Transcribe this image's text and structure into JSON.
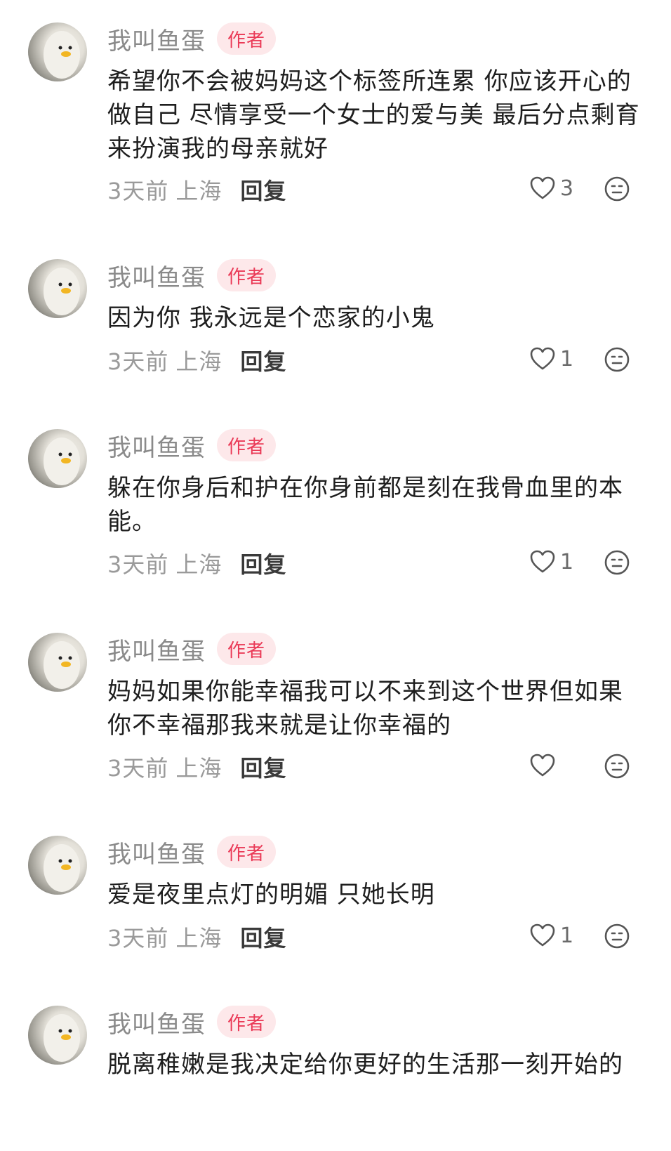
{
  "comments": [
    {
      "username": "我叫鱼蛋",
      "badge": "作者",
      "text": "希望你不会被妈妈这个标签所连累 你应该开心的做自己 尽情享受一个女士的爱与美 最后分点剩育来扮演我的母亲就好",
      "time": "3天前",
      "location": "上海",
      "reply": "回复",
      "likes": "3"
    },
    {
      "username": "我叫鱼蛋",
      "badge": "作者",
      "text": "因为你 我永远是个恋家的小鬼",
      "time": "3天前",
      "location": "上海",
      "reply": "回复",
      "likes": "1"
    },
    {
      "username": "我叫鱼蛋",
      "badge": "作者",
      "text": "躲在你身后和护在你身前都是刻在我骨血里的本能。",
      "time": "3天前",
      "location": "上海",
      "reply": "回复",
      "likes": "1"
    },
    {
      "username": "我叫鱼蛋",
      "badge": "作者",
      "text": "妈妈如果你能幸福我可以不来到这个世界但如果你不幸福那我来就是让你幸福的",
      "time": "3天前",
      "location": "上海",
      "reply": "回复",
      "likes": ""
    },
    {
      "username": "我叫鱼蛋",
      "badge": "作者",
      "text": "爱是夜里点灯的明媚 只她长明",
      "time": "3天前",
      "location": "上海",
      "reply": "回复",
      "likes": "1"
    },
    {
      "username": "我叫鱼蛋",
      "badge": "作者",
      "text": "脱离稚嫩是我决定给你更好的生活那一刻开始的",
      "time": "",
      "location": "",
      "reply": "",
      "likes": ""
    }
  ],
  "icons": {
    "like": "heart-outline-icon",
    "emoji": "smiley-face-icon"
  },
  "colors": {
    "badge_text": "#ea3a57",
    "badge_bg": "#fde8ea",
    "muted_text": "#9a9a9a",
    "username": "#8a8a8a"
  }
}
